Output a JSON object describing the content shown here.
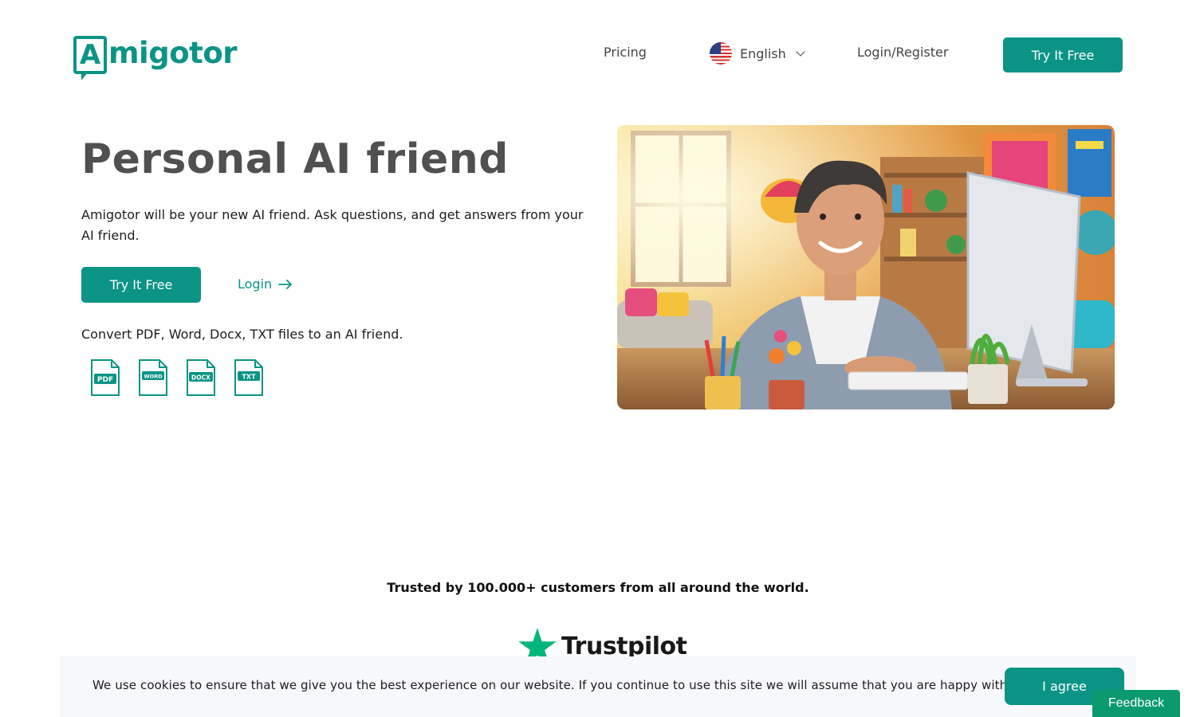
{
  "header": {
    "logo_text": "Amigotor",
    "nav": {
      "pricing": "Pricing",
      "language": "English",
      "login_register": "Login/Register",
      "try_free": "Try It Free"
    }
  },
  "hero": {
    "title": "Personal AI friend",
    "description": "Amigotor will be your new AI friend. Ask questions, and get answers from your AI friend.",
    "try_button": "Try It Free",
    "login_link": "Login",
    "convert_text": "Convert PDF, Word, Docx, TXT files to an AI friend.",
    "file_types": [
      "PDF",
      "WORD",
      "DOCX",
      "TXT"
    ]
  },
  "trust": {
    "text": "Trusted by 100.000+ customers from all around the world.",
    "brand": "Trustpilot"
  },
  "cookie": {
    "message": "We use cookies to ensure that we give you the best experience on our website. If you continue to use this site we will assume that you are happy with it.",
    "agree_button": "I agree"
  },
  "feedback": {
    "label": "Feedback"
  },
  "colors": {
    "brand": "#0b9485",
    "feedback": "#0b9a70",
    "heading": "#505050"
  }
}
